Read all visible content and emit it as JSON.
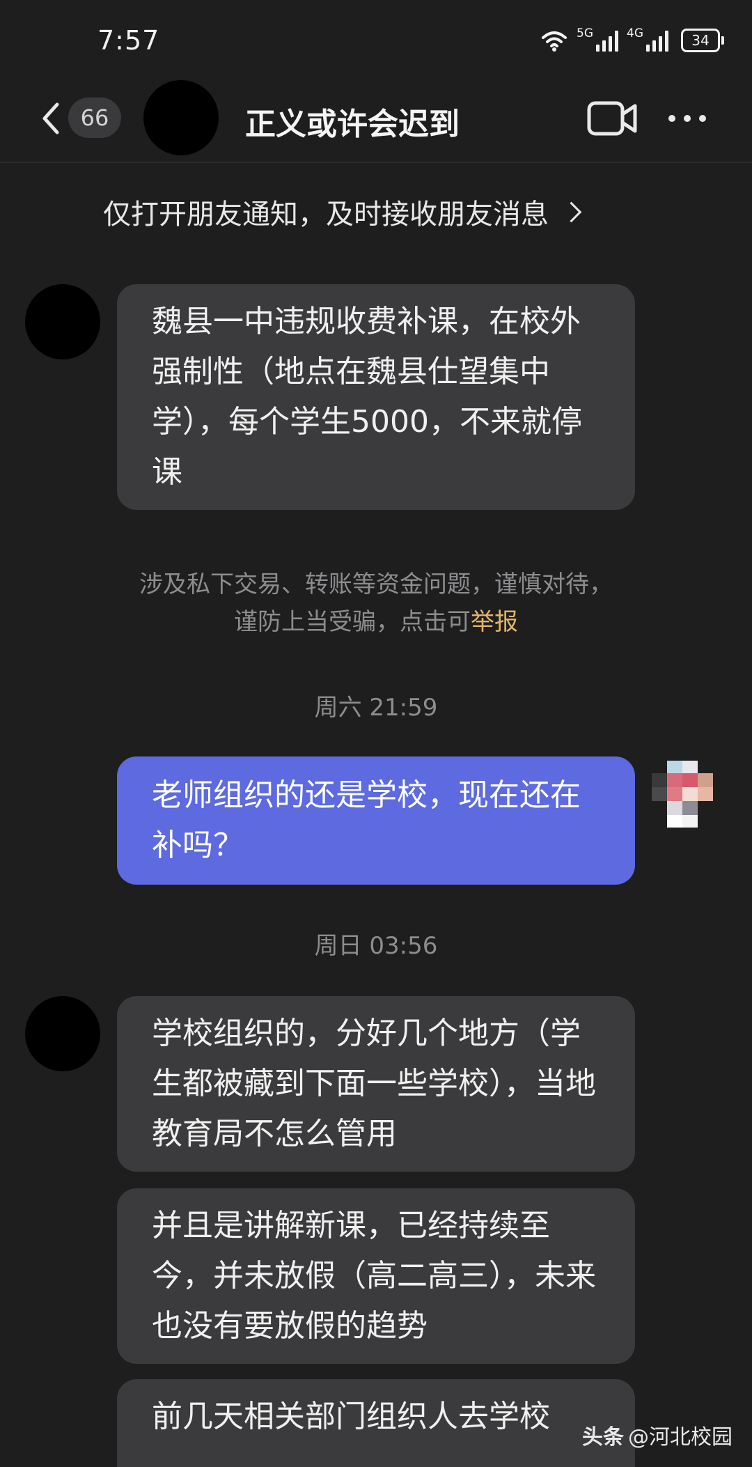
{
  "status_bar": {
    "time": "7:57",
    "network1": "5G",
    "network2": "4G",
    "battery": "34"
  },
  "header": {
    "unread_count": "66",
    "title": "正义或许会迟到",
    "icons": [
      "back-icon",
      "video-call-icon",
      "more-icon"
    ]
  },
  "notify_bar": {
    "text": "仅打开朋友通知，及时接收朋友消息"
  },
  "messages": [
    {
      "side": "in",
      "text": "魏县一中违规收费补课，在校外强制性（地点在魏县仕望集中学），每个学生5000，不来就停课"
    },
    {
      "side": "out",
      "text": "老师组织的还是学校，现在还在补吗？"
    },
    {
      "side": "in",
      "text": "学校组织的，分好几个地方（学生都被藏到下面一些学校），当地教育局不怎么管用"
    },
    {
      "side": "in",
      "text": "并且是讲解新课，已经持续至今，并未放假（高二高三），未来也没有要放假的趋势"
    },
    {
      "side": "in",
      "text": "前几天相关部门组织人去学校"
    }
  ],
  "safety_notice": {
    "text": "涉及私下交易、转账等资金问题，谨慎对待，谨防上当受骗，点击可",
    "link": "举报"
  },
  "timestamps": [
    "周六 21:59",
    "周日 03:56"
  ],
  "watermark": {
    "brand": "头条",
    "account": "@河北校园"
  },
  "colors": {
    "background": "#1e1e1f",
    "bubble_in": "#3b3b3d",
    "bubble_out": "#5d6ae0",
    "report_link": "#e3b66a"
  }
}
